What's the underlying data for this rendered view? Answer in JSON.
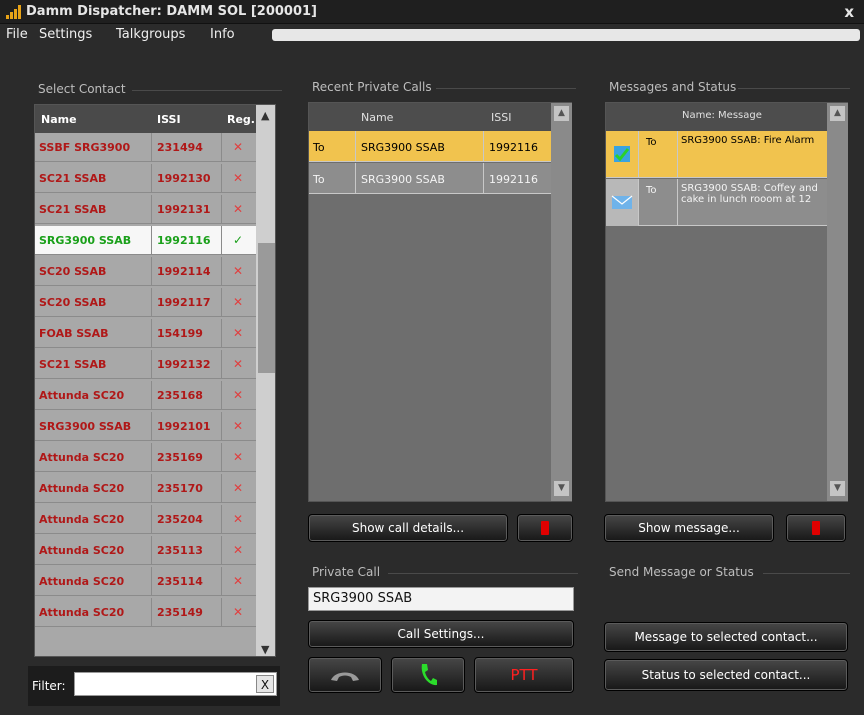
{
  "window": {
    "title": "Damm Dispatcher: DAMM SOL [200001]",
    "close_glyph": "x"
  },
  "menu": [
    "File",
    "Settings",
    "Talkgroups",
    "Info"
  ],
  "select_contact": {
    "label": "Select Contact",
    "columns": [
      "Name",
      "ISSI",
      "Reg."
    ],
    "rows": [
      {
        "name": "SSBF SRG3900",
        "issi": "231494",
        "reg": "✕"
      },
      {
        "name": "SC21 SSAB",
        "issi": "1992130",
        "reg": "✕"
      },
      {
        "name": "SC21 SSAB",
        "issi": "1992131",
        "reg": "✕"
      },
      {
        "name": "SRG3900 SSAB",
        "issi": "1992116",
        "reg": "✓"
      },
      {
        "name": "SC20 SSAB",
        "issi": "1992114",
        "reg": "✕"
      },
      {
        "name": "SC20 SSAB",
        "issi": "1992117",
        "reg": "✕"
      },
      {
        "name": "FOAB SSAB",
        "issi": "154199",
        "reg": "✕"
      },
      {
        "name": "SC21 SSAB",
        "issi": "1992132",
        "reg": "✕"
      },
      {
        "name": "Attunda SC20",
        "issi": "235168",
        "reg": "✕"
      },
      {
        "name": "SRG3900 SSAB",
        "issi": "1992101",
        "reg": "✕"
      },
      {
        "name": "Attunda SC20",
        "issi": "235169",
        "reg": "✕"
      },
      {
        "name": "Attunda SC20",
        "issi": "235170",
        "reg": "✕"
      },
      {
        "name": "Attunda SC20",
        "issi": "235204",
        "reg": "✕"
      },
      {
        "name": "Attunda SC20",
        "issi": "235113",
        "reg": "✕"
      },
      {
        "name": "Attunda SC20",
        "issi": "235114",
        "reg": "✕"
      },
      {
        "name": "Attunda SC20",
        "issi": "235149",
        "reg": "✕"
      }
    ],
    "filter_label": "Filter:",
    "filter_value": "",
    "filter_clear": "X"
  },
  "recent_calls": {
    "label": "Recent Private Calls",
    "columns": [
      "",
      "Name",
      "ISSI"
    ],
    "rows": [
      {
        "dir": "To",
        "name": "SRG3900 SSAB",
        "issi": "1992116"
      },
      {
        "dir": "To",
        "name": "SRG3900 SSAB",
        "issi": "1992116"
      }
    ],
    "show_button": "Show call details..."
  },
  "messages": {
    "label": "Messages and Status",
    "columns": [
      "",
      "",
      "Name: Message"
    ],
    "rows": [
      {
        "icon": "status-icon",
        "dir": "To",
        "text": "SRG3900 SSAB: Fire Alarm"
      },
      {
        "icon": "envelope-icon",
        "dir": "To",
        "text": "SRG3900 SSAB: Coffey and cake in lunch rooom at 12"
      }
    ],
    "show_button": "Show message..."
  },
  "private_call": {
    "label": "Private Call",
    "value": "SRG3900 SSAB",
    "settings_button": "Call Settings...",
    "ptt_label": "PTT"
  },
  "send": {
    "label": "Send Message or Status",
    "message_button": "Message to selected contact...",
    "status_button": "Status to selected contact..."
  },
  "colors": {
    "accent": "#f1c34e",
    "registered": "#1aa01a",
    "unregistered": "#b01818"
  }
}
